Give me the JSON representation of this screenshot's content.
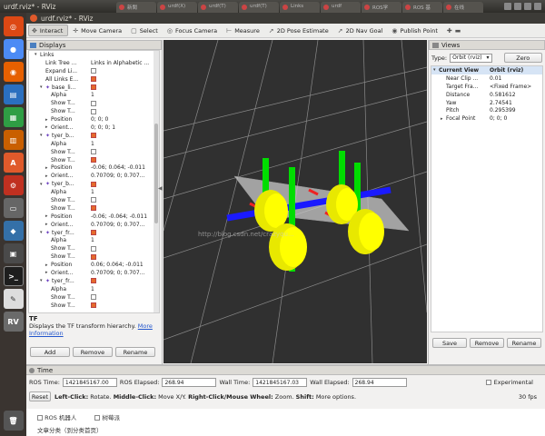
{
  "topbar": {
    "title": "urdf.rviz* - RViz",
    "browser_tabs": [
      "新聞",
      "urdf(X)",
      "urdf(T)",
      "urdf(T)",
      "Links",
      "urdf",
      "ROS学",
      "ROS 基",
      "在线"
    ]
  },
  "window": {
    "title": "urdf.rviz* - RViz"
  },
  "toolbar": {
    "tools": [
      {
        "label": "Interact",
        "icon": "interact-icon",
        "active": true
      },
      {
        "label": "Move Camera",
        "icon": "move-camera-icon"
      },
      {
        "label": "Select",
        "icon": "select-icon"
      },
      {
        "label": "Focus Camera",
        "icon": "focus-camera-icon"
      },
      {
        "label": "Measure",
        "icon": "measure-icon"
      },
      {
        "label": "2D Pose Estimate",
        "icon": "pose-estimate-icon"
      },
      {
        "label": "2D Nav Goal",
        "icon": "nav-goal-icon"
      },
      {
        "label": "Publish Point",
        "icon": "publish-point-icon"
      }
    ]
  },
  "displays": {
    "title": "Displays",
    "rows": [
      {
        "indent": 1,
        "arrow": "▾",
        "key": "Links",
        "value": "",
        "cb": null
      },
      {
        "indent": 2,
        "arrow": "",
        "key": "Link Tree ...",
        "value": "Links in Alphabetic ...",
        "cb": null
      },
      {
        "indent": 2,
        "arrow": "",
        "key": "Expand Li...",
        "value": "",
        "cb": "off"
      },
      {
        "indent": 2,
        "arrow": "",
        "key": "All Links E...",
        "value": "",
        "cb": "on"
      },
      {
        "indent": 2,
        "arrow": "▾",
        "key": "base_li...",
        "value": "",
        "cb": "on",
        "dot": true
      },
      {
        "indent": 3,
        "arrow": "",
        "key": "Alpha",
        "value": "1",
        "cb": null
      },
      {
        "indent": 3,
        "arrow": "",
        "key": "Show T...",
        "value": "",
        "cb": "off"
      },
      {
        "indent": 3,
        "arrow": "",
        "key": "Show T...",
        "value": "",
        "cb": "off"
      },
      {
        "indent": 3,
        "arrow": "▸",
        "key": "Position",
        "value": "0; 0; 0",
        "cb": null
      },
      {
        "indent": 3,
        "arrow": "▸",
        "key": "Orient...",
        "value": "0; 0; 0; 1",
        "cb": null
      },
      {
        "indent": 2,
        "arrow": "▾",
        "key": "tyer_b...",
        "value": "",
        "cb": "on",
        "dot": true
      },
      {
        "indent": 3,
        "arrow": "",
        "key": "Alpha",
        "value": "1",
        "cb": null
      },
      {
        "indent": 3,
        "arrow": "",
        "key": "Show T...",
        "value": "",
        "cb": "off"
      },
      {
        "indent": 3,
        "arrow": "",
        "key": "Show T...",
        "value": "",
        "cb": "on"
      },
      {
        "indent": 3,
        "arrow": "▸",
        "key": "Position",
        "value": "-0.06; 0.064; -0.011",
        "cb": null
      },
      {
        "indent": 3,
        "arrow": "▸",
        "key": "Orient...",
        "value": "0.70709; 0; 0.707...",
        "cb": null
      },
      {
        "indent": 2,
        "arrow": "▾",
        "key": "tyer_b...",
        "value": "",
        "cb": "on",
        "dot": true
      },
      {
        "indent": 3,
        "arrow": "",
        "key": "Alpha",
        "value": "1",
        "cb": null
      },
      {
        "indent": 3,
        "arrow": "",
        "key": "Show T...",
        "value": "",
        "cb": "off"
      },
      {
        "indent": 3,
        "arrow": "",
        "key": "Show T...",
        "value": "",
        "cb": "on"
      },
      {
        "indent": 3,
        "arrow": "▸",
        "key": "Position",
        "value": "-0.06; -0.064; -0.011",
        "cb": null
      },
      {
        "indent": 3,
        "arrow": "▸",
        "key": "Orient...",
        "value": "0.70709; 0; 0.707...",
        "cb": null
      },
      {
        "indent": 2,
        "arrow": "▾",
        "key": "tyer_fr...",
        "value": "",
        "cb": "on",
        "dot": true
      },
      {
        "indent": 3,
        "arrow": "",
        "key": "Alpha",
        "value": "1",
        "cb": null
      },
      {
        "indent": 3,
        "arrow": "",
        "key": "Show T...",
        "value": "",
        "cb": "off"
      },
      {
        "indent": 3,
        "arrow": "",
        "key": "Show T...",
        "value": "",
        "cb": "on"
      },
      {
        "indent": 3,
        "arrow": "▸",
        "key": "Position",
        "value": "0.06; 0.064; -0.011",
        "cb": null
      },
      {
        "indent": 3,
        "arrow": "▸",
        "key": "Orient...",
        "value": "0.70709; 0; 0.707...",
        "cb": null
      },
      {
        "indent": 2,
        "arrow": "▾",
        "key": "tyer_fr...",
        "value": "",
        "cb": "on",
        "dot": true
      },
      {
        "indent": 3,
        "arrow": "",
        "key": "Alpha",
        "value": "1",
        "cb": null
      },
      {
        "indent": 3,
        "arrow": "",
        "key": "Show T...",
        "value": "",
        "cb": "off"
      },
      {
        "indent": 3,
        "arrow": "",
        "key": "Show T...",
        "value": "",
        "cb": "on"
      }
    ],
    "tf_title": "TF",
    "tf_desc": "Displays the TF transform hierarchy.",
    "tf_link": "More Information",
    "buttons": [
      "Add",
      "Remove",
      "Rename"
    ]
  },
  "viewport": {
    "watermark": "http://blog.csdn.net/crazyqu...",
    "colors": {
      "background": "#303030",
      "grid": "#9a9a9a",
      "wheel": "#ffff00",
      "axis_z": "#00dd00",
      "axis_y": "#1a1aff",
      "axis_x": "#ee2222"
    }
  },
  "views": {
    "title": "Views",
    "type_label": "Type:",
    "type_value": "Orbit (rviz)",
    "zero_label": "Zero",
    "rows": [
      {
        "key": "Current View",
        "value": "Orbit (rviz)",
        "head": true,
        "arrow": "▾"
      },
      {
        "key": "Near Clip ...",
        "value": "0.01"
      },
      {
        "key": "Target Fra...",
        "value": "<Fixed Frame>"
      },
      {
        "key": "Distance",
        "value": "0.581612"
      },
      {
        "key": "Yaw",
        "value": "2.74541"
      },
      {
        "key": "Pitch",
        "value": "0.295399"
      },
      {
        "key": "Focal Point",
        "value": "0; 0; 0",
        "arrow": "▸"
      }
    ],
    "buttons": [
      "Save",
      "Remove",
      "Rename"
    ]
  },
  "time": {
    "title": "Time",
    "ros_time_label": "ROS Time:",
    "ros_time": "1421845167.00",
    "ros_elapsed_label": "ROS Elapsed:",
    "ros_elapsed": "268.94",
    "wall_time_label": "Wall Time:",
    "wall_time": "1421845167.03",
    "wall_elapsed_label": "Wall Elapsed:",
    "wall_elapsed": "268.94",
    "experimental": "Experimental",
    "reset": "Reset",
    "hint_bold1": "Left-Click:",
    "hint1": "Rotate.",
    "hint_bold2": "Middle-Click:",
    "hint2": "Move X/Y.",
    "hint_bold3": "Right-Click/Mouse Wheel:",
    "hint3": "Zoom.",
    "hint_bold4": "Shift:",
    "hint4": "More options.",
    "fps": "30 fps"
  },
  "behind": {
    "opt1": "ROS 机器人",
    "opt2": "树莓派",
    "line2": "文章分类（到分类首页）"
  }
}
